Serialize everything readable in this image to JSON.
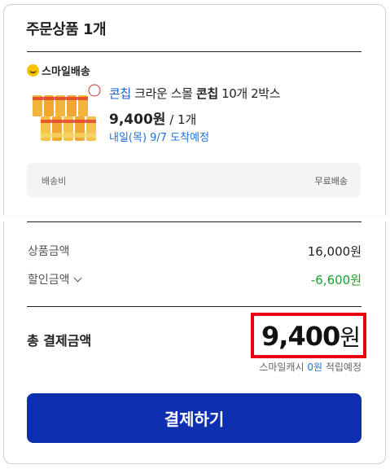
{
  "header": {
    "title": "주문상품 1개"
  },
  "badge": {
    "icon": "smile-icon",
    "label": "스마일배송"
  },
  "product": {
    "name_brand": "콘칩",
    "name_rest": " 크라운 스몰 ",
    "name_bold": "콘칩",
    "name_tail": " 10개 2박스",
    "price": "9,400원",
    "qty": " / 1개",
    "delivery": "내일(목) 9/7 도착예정"
  },
  "shipping": {
    "label": "배송비",
    "value": "무료배송"
  },
  "summary": {
    "product_amount_label": "상품금액",
    "product_amount_value": "16,000원",
    "discount_label": "할인금액",
    "discount_value": "-6,600원"
  },
  "total": {
    "label": "총 결제금액",
    "amount": "9,400",
    "unit": "원",
    "cash_prefix": "스마일캐시 ",
    "cash_amount": "0원",
    "cash_suffix": " 적립예정"
  },
  "pay_button": {
    "label": "결제하기"
  },
  "colors": {
    "accent": "#0d2fb0",
    "highlight": "#e60012",
    "discount": "#1aa12d",
    "link": "#1a73d9"
  }
}
